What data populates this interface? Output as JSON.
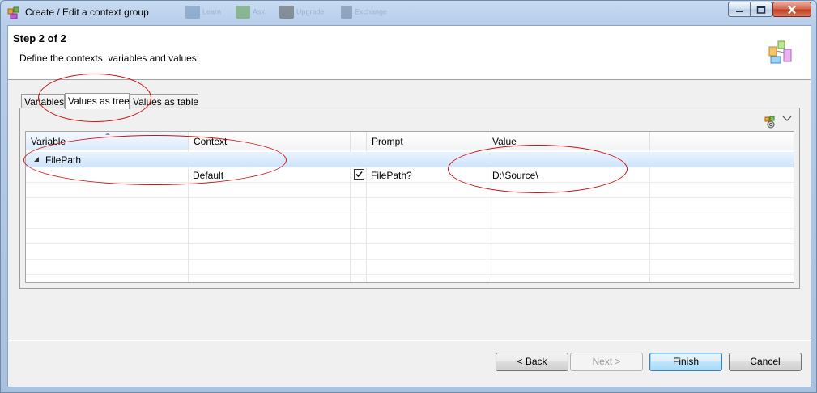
{
  "window": {
    "title": "Create / Edit a context group",
    "background_taskbar": [
      "Learn",
      "Ask",
      "Upgrade",
      "Exchange"
    ]
  },
  "header": {
    "step_title": "Step 2 of 2",
    "step_description": "Define the contexts, variables and values",
    "icon": "wizard-banner-icon"
  },
  "tabs": [
    {
      "label": "Variables",
      "active": false
    },
    {
      "label": "Values as tree",
      "active": true
    },
    {
      "label": "Values as table",
      "active": false
    }
  ],
  "grid": {
    "columns": [
      "Variable",
      "Context",
      "",
      "Prompt",
      "Value"
    ],
    "sorted_column": "Variable",
    "rows": [
      {
        "variable": "FilePath",
        "expanded": true,
        "context": "",
        "checked": null,
        "prompt": "",
        "value": ""
      },
      {
        "variable": "",
        "context": "Default",
        "checked": true,
        "prompt": "FilePath?",
        "value": "D:\\Source\\"
      }
    ]
  },
  "buttons": {
    "back": "Back",
    "back_prefix": "< ",
    "next": "Next >",
    "finish": "Finish",
    "cancel": "Cancel"
  },
  "colors": {
    "selected_row": "#cfe4fb",
    "annotation": "#d01010",
    "default_button": "#a7d9f5"
  }
}
